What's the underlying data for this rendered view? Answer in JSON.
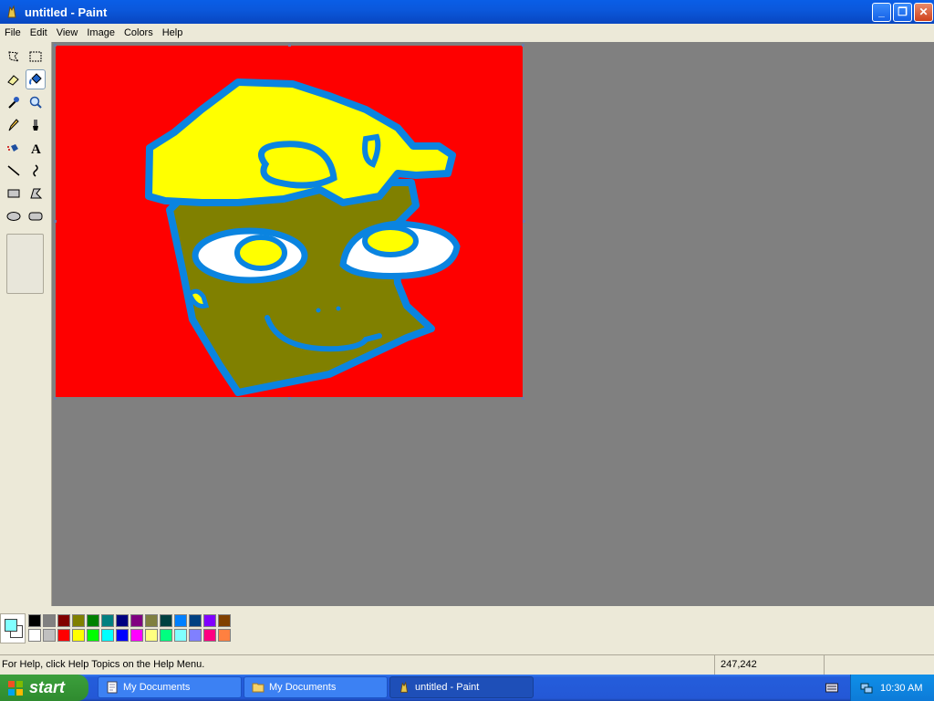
{
  "window": {
    "title": "untitled - Paint"
  },
  "menu": {
    "items": [
      "File",
      "Edit",
      "View",
      "Image",
      "Colors",
      "Help"
    ]
  },
  "toolbox": {
    "tools": [
      "free-form-select-icon",
      "select-icon",
      "eraser-icon",
      "fill-icon",
      "pick-color-icon",
      "magnifier-icon",
      "pencil-icon",
      "brush-icon",
      "airbrush-icon",
      "text-icon",
      "line-icon",
      "curve-icon",
      "rectangle-icon",
      "polygon-icon",
      "ellipse-icon",
      "rounded-rectangle-icon"
    ],
    "selected": "fill-icon"
  },
  "colors": {
    "foreground": "#80ffff",
    "background": "#ffffff",
    "palette_top": [
      "#000000",
      "#808080",
      "#800000",
      "#808000",
      "#008000",
      "#008080",
      "#000080",
      "#800080",
      "#808040",
      "#004040",
      "#0080ff",
      "#004080",
      "#8000ff",
      "#804000"
    ],
    "palette_bottom": [
      "#ffffff",
      "#c0c0c0",
      "#ff0000",
      "#ffff00",
      "#00ff00",
      "#00ffff",
      "#0000ff",
      "#ff00ff",
      "#ffff80",
      "#00ff80",
      "#80ffff",
      "#8080ff",
      "#ff0080",
      "#ff8040"
    ]
  },
  "status": {
    "help": "For Help, click Help Topics on the Help Menu.",
    "coords": "247,242"
  },
  "taskbar": {
    "start": "start",
    "tasks": [
      "My Documents",
      "My Documents",
      "untitled - Paint"
    ],
    "clock": "10:30 AM"
  }
}
